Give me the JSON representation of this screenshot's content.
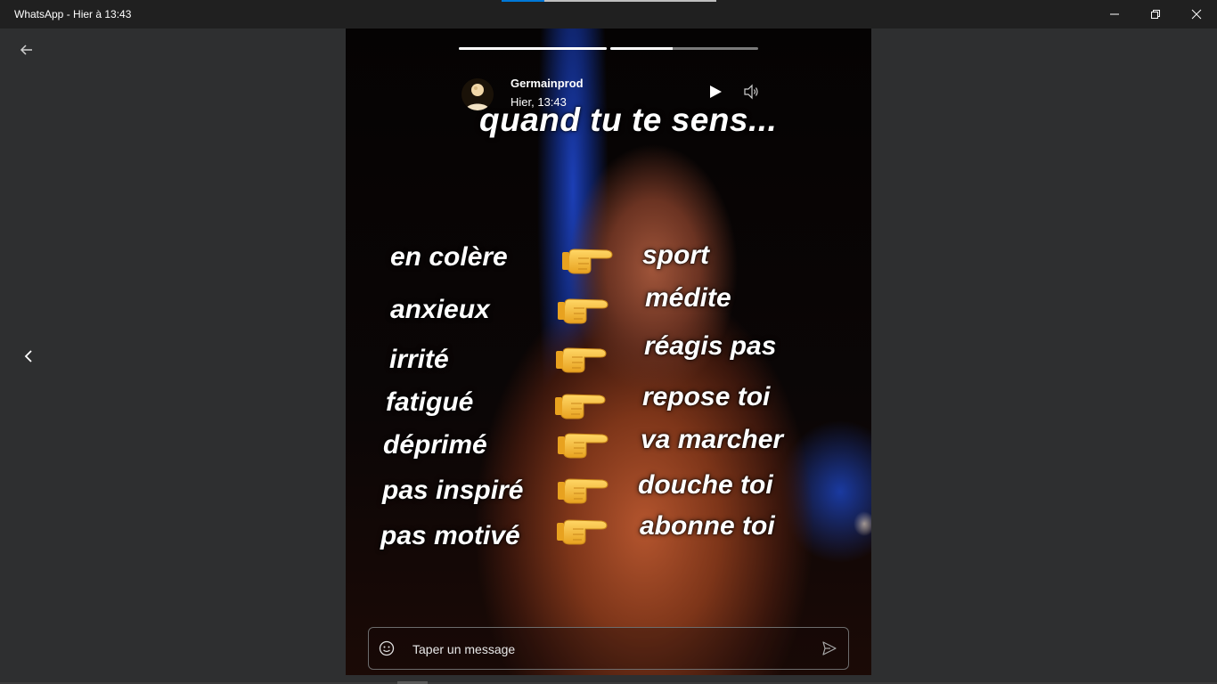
{
  "window": {
    "title": "WhatsApp - Hier à 13:43",
    "minimize_icon": "minimize-icon",
    "restore_icon": "restore-icon",
    "close_icon": "close-icon"
  },
  "nav": {
    "back_icon": "arrow-left-icon",
    "previous_icon": "chevron-left-icon"
  },
  "status": {
    "author": "Germainprod",
    "time": "Hier, 13:43",
    "segments": [
      {
        "progress": 1.0
      },
      {
        "progress": 0.42
      }
    ],
    "play_icon": "play-icon",
    "volume_icon": "speaker-icon"
  },
  "story": {
    "headline": "quand tu te sens...",
    "pairs": [
      {
        "feeling": "en colère",
        "advice": "sport"
      },
      {
        "feeling": "anxieux",
        "advice": "médite"
      },
      {
        "feeling": "irrité",
        "advice": "réagis pas"
      },
      {
        "feeling": "fatigué",
        "advice": "repose toi"
      },
      {
        "feeling": "déprimé",
        "advice": "va marcher"
      },
      {
        "feeling": "pas inspiré",
        "advice": "douche toi"
      },
      {
        "feeling": "pas motivé",
        "advice": "abonne toi"
      }
    ],
    "hand_icon": "pointing-right-hand-icon"
  },
  "reply": {
    "placeholder": "Taper un message",
    "emoji_icon": "emoji-icon",
    "send_icon": "send-icon"
  },
  "colors": {
    "window_bg": "#2e2f30",
    "titlebar_bg": "#202020",
    "accent": "#0078d7"
  }
}
